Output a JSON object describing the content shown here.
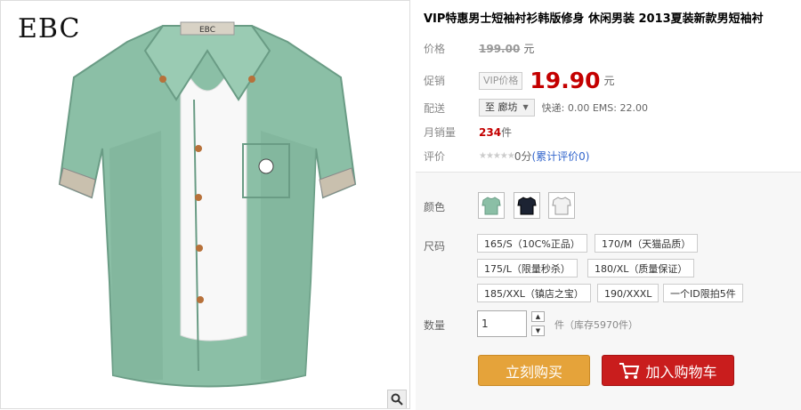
{
  "gallery": {
    "brand": "EBC",
    "collar_label": "EBC",
    "zoom_icon": "magnifier-icon",
    "image_icon": "green-shirt-image"
  },
  "product": {
    "title": "VIP特惠男士短袖衬衫韩版修身 休闲男装 2013夏装新款男短袖衬"
  },
  "price": {
    "label": "价格",
    "value": "199.00",
    "unit": "元"
  },
  "promo": {
    "label": "促销",
    "badge": "VIP价格",
    "value": "19.90",
    "unit": "元",
    "color": "#c40000"
  },
  "delivery": {
    "label": "配送",
    "destination": "至 廊坊",
    "express": "快递: 0.00 EMS: 22.00"
  },
  "sales": {
    "label": "月销量",
    "count": "234",
    "unit": "件"
  },
  "rating": {
    "label": "评价",
    "stars": "★★★★★",
    "score": "0分",
    "link_open": "(",
    "link": "累计评价0",
    "link_close": ")"
  },
  "options": {
    "color_label": "颜色",
    "colors": [
      "green",
      "navy",
      "white"
    ],
    "size_label": "尺码",
    "sizes": [
      "165/S（10C%正品）",
      "170/M（天猫品质）",
      "175/L（限量秒杀）",
      "180/XL（质量保证）",
      "185/XXL（镇店之宝）",
      "190/XXXL",
      "一个ID限拍5件"
    ],
    "qty_label": "数量",
    "qty_value": "1",
    "stock": "件（库存5970件）"
  },
  "actions": {
    "buy": "立刻购买",
    "cart": "加入购物车"
  }
}
